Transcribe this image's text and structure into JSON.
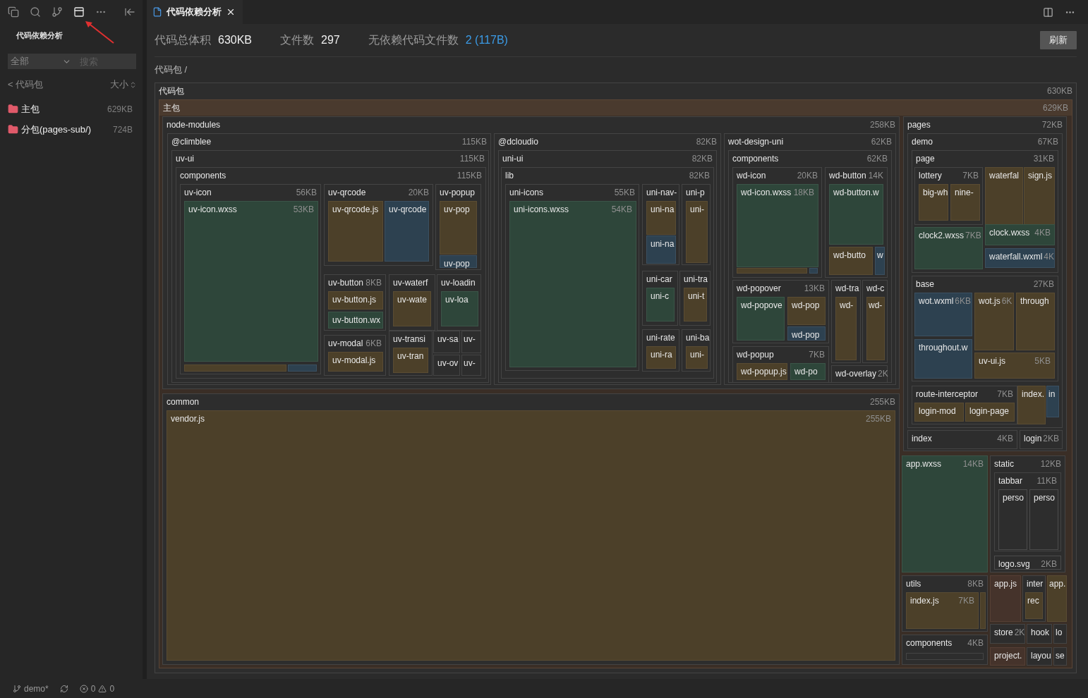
{
  "sidebar": {
    "title": "代码依赖分析",
    "filter": {
      "value": "全部"
    },
    "search": {
      "placeholder": "搜索"
    },
    "header": {
      "back": "< 代码包",
      "sort": "大小"
    },
    "items": [
      {
        "name": "主包",
        "size": "629KB"
      },
      {
        "name": "分包(pages-sub/)",
        "size": "724B"
      }
    ]
  },
  "tab": {
    "title": "代码依赖分析"
  },
  "stats": [
    {
      "label": "代码总体积",
      "value": "630KB",
      "kind": "plain"
    },
    {
      "label": "文件数",
      "value": "297",
      "kind": "plain"
    },
    {
      "label": "无依赖代码文件数",
      "value": "2 (117B)",
      "kind": "link"
    }
  ],
  "refresh_button": "刷新",
  "breadcrumb": "代码包 /",
  "treemap": {
    "name": "代码包",
    "size": "630KB",
    "kind": "folder",
    "children": [
      {
        "name": "主包",
        "size": "629KB",
        "kind": "package",
        "children": [
          {
            "name": "node-modules",
            "size": "258KB",
            "kind": "folder",
            "children": [
              {
                "name": "@climblee",
                "size": "115KB",
                "kind": "folder",
                "children": [
                  {
                    "name": "uv-ui",
                    "size": "115KB",
                    "kind": "folder",
                    "children": [
                      {
                        "name": "components",
                        "size": "115KB",
                        "kind": "folder",
                        "children": [
                          {
                            "name": "uv-icon",
                            "size": "56KB",
                            "kind": "folder",
                            "children": [
                              {
                                "name": "uv-icon.wxss",
                                "size": "53KB",
                                "kind": "style"
                              },
                              {
                                "kind": "script"
                              },
                              {
                                "kind": "markup"
                              }
                            ]
                          },
                          {
                            "name": "uv-qrcode",
                            "size": "20KB",
                            "kind": "folder",
                            "children": [
                              {
                                "name": "uv-qrcode.js",
                                "kind": "script"
                              },
                              {
                                "name": "uv-qrcode",
                                "kind": "markup"
                              }
                            ]
                          },
                          {
                            "name": "uv-popup",
                            "kind": "folder",
                            "children": [
                              {
                                "name": "uv-pop",
                                "kind": "script"
                              },
                              {
                                "name": "uv-pop",
                                "kind": "markup"
                              }
                            ]
                          },
                          {
                            "name": "uv-button",
                            "size": "8KB",
                            "kind": "folder",
                            "children": [
                              {
                                "name": "uv-button.js",
                                "kind": "script"
                              },
                              {
                                "name": "uv-button.wx",
                                "kind": "style"
                              }
                            ]
                          },
                          {
                            "name": "uv-waterf",
                            "kind": "folder",
                            "children": [
                              {
                                "name": "uv-wate",
                                "kind": "script"
                              }
                            ]
                          },
                          {
                            "name": "uv-loadin",
                            "kind": "folder",
                            "children": [
                              {
                                "name": "uv-loa",
                                "kind": "style"
                              }
                            ]
                          },
                          {
                            "name": "uv-modal",
                            "size": "6KB",
                            "kind": "folder",
                            "children": [
                              {
                                "name": "uv-modal.js",
                                "kind": "script"
                              }
                            ]
                          },
                          {
                            "name": "uv-transi",
                            "kind": "folder",
                            "children": [
                              {
                                "name": "uv-tran",
                                "kind": "script"
                              }
                            ]
                          },
                          {
                            "name": "uv-sa",
                            "kind": "folder"
                          },
                          {
                            "name": "uv-",
                            "kind": "folder"
                          },
                          {
                            "name": "uv-ov",
                            "kind": "folder"
                          },
                          {
                            "name": "uv-",
                            "kind": "folder"
                          }
                        ]
                      }
                    ]
                  }
                ]
              },
              {
                "name": "@dcloudio",
                "size": "82KB",
                "kind": "folder",
                "children": [
                  {
                    "name": "uni-ui",
                    "size": "82KB",
                    "kind": "folder",
                    "children": [
                      {
                        "name": "lib",
                        "size": "82KB",
                        "kind": "folder",
                        "children": [
                          {
                            "name": "uni-icons",
                            "size": "55KB",
                            "kind": "folder",
                            "children": [
                              {
                                "name": "uni-icons.wxss",
                                "size": "54KB",
                                "kind": "style"
                              }
                            ]
                          },
                          {
                            "name": "uni-nav-",
                            "kind": "folder",
                            "children": [
                              {
                                "name": "uni-na",
                                "kind": "script"
                              },
                              {
                                "name": "uni-na",
                                "kind": "markup"
                              }
                            ]
                          },
                          {
                            "name": "uni-p",
                            "kind": "folder",
                            "children": [
                              {
                                "name": "uni-",
                                "kind": "script"
                              }
                            ]
                          },
                          {
                            "name": "uni-car",
                            "kind": "folder",
                            "children": [
                              {
                                "name": "uni-c",
                                "kind": "style"
                              }
                            ]
                          },
                          {
                            "name": "uni-tra",
                            "kind": "folder",
                            "children": [
                              {
                                "name": "uni-t",
                                "kind": "script"
                              }
                            ]
                          },
                          {
                            "name": "uni-rate",
                            "kind": "folder",
                            "children": [
                              {
                                "name": "uni-ra",
                                "kind": "script"
                              }
                            ]
                          },
                          {
                            "name": "uni-ba",
                            "kind": "folder",
                            "children": [
                              {
                                "name": "uni-",
                                "kind": "script"
                              }
                            ]
                          }
                        ]
                      }
                    ]
                  }
                ]
              },
              {
                "name": "wot-design-uni",
                "size": "62KB",
                "kind": "folder",
                "children": [
                  {
                    "name": "components",
                    "size": "62KB",
                    "kind": "folder",
                    "children": [
                      {
                        "name": "wd-icon",
                        "size": "20KB",
                        "kind": "folder",
                        "children": [
                          {
                            "name": "wd-icon.wxss",
                            "size": "18KB",
                            "kind": "style"
                          },
                          {
                            "kind": "script"
                          },
                          {
                            "kind": "markup"
                          }
                        ]
                      },
                      {
                        "name": "wd-button",
                        "size": "14K",
                        "kind": "folder",
                        "children": [
                          {
                            "name": "wd-button.w",
                            "kind": "style"
                          },
                          {
                            "name": "wd-butto",
                            "kind": "script"
                          },
                          {
                            "name": "w",
                            "kind": "markup"
                          }
                        ]
                      },
                      {
                        "name": "wd-popover",
                        "size": "13KB",
                        "kind": "folder",
                        "children": [
                          {
                            "name": "wd-popove",
                            "kind": "style"
                          },
                          {
                            "name": "wd-pop",
                            "kind": "script"
                          },
                          {
                            "name": "wd-pop",
                            "kind": "markup"
                          }
                        ]
                      },
                      {
                        "name": "wd-popup",
                        "size": "7KB",
                        "kind": "folder",
                        "children": [
                          {
                            "name": "wd-popup.js",
                            "kind": "script"
                          },
                          {
                            "name": "wd-po",
                            "kind": "style"
                          }
                        ]
                      },
                      {
                        "name": "wd-tra",
                        "kind": "folder",
                        "children": [
                          {
                            "name": "wd-",
                            "kind": "script"
                          }
                        ]
                      },
                      {
                        "name": "wd-c",
                        "kind": "folder",
                        "children": [
                          {
                            "name": "wd-",
                            "kind": "script"
                          }
                        ]
                      },
                      {
                        "name": "wd-overlay",
                        "size": "2K",
                        "kind": "folder"
                      }
                    ]
                  }
                ]
              }
            ]
          },
          {
            "name": "pages",
            "size": "72KB",
            "kind": "folder",
            "children": [
              {
                "name": "demo",
                "size": "67KB",
                "kind": "folder",
                "children": [
                  {
                    "name": "page",
                    "size": "31KB",
                    "kind": "folder",
                    "children": [
                      {
                        "name": "lottery",
                        "size": "7KB",
                        "kind": "folder",
                        "children": [
                          {
                            "name": "big-wh",
                            "kind": "script"
                          },
                          {
                            "name": "nine-",
                            "kind": "script"
                          }
                        ]
                      },
                      {
                        "name": "waterfal",
                        "kind": "script"
                      },
                      {
                        "name": "sign.js",
                        "kind": "script"
                      },
                      {
                        "name": "clock2.wxss",
                        "size": "7KB",
                        "kind": "style"
                      },
                      {
                        "name": "clock.wxss",
                        "size": "4KB",
                        "kind": "style"
                      },
                      {
                        "name": "waterfall.wxml",
                        "size": "4K",
                        "kind": "markup"
                      }
                    ]
                  },
                  {
                    "name": "base",
                    "size": "27KB",
                    "kind": "folder",
                    "children": [
                      {
                        "name": "wot.wxml",
                        "size": "6KB",
                        "kind": "markup"
                      },
                      {
                        "name": "wot.js",
                        "size": "6K",
                        "kind": "script"
                      },
                      {
                        "name": "through",
                        "kind": "script"
                      },
                      {
                        "name": "throughout.w",
                        "kind": "markup"
                      },
                      {
                        "name": "uv-ui.js",
                        "size": "5KB",
                        "kind": "script"
                      }
                    ]
                  },
                  {
                    "name": "route-interceptor",
                    "size": "7KB",
                    "kind": "folder",
                    "children": [
                      {
                        "name": "login-mod",
                        "kind": "script"
                      },
                      {
                        "name": "login-page",
                        "kind": "script"
                      }
                    ]
                  },
                  {
                    "name": "index.",
                    "kind": "script"
                  },
                  {
                    "name": "in",
                    "kind": "markup"
                  }
                ]
              },
              {
                "name": "index",
                "size": "4KB",
                "kind": "folder"
              },
              {
                "name": "login",
                "size": "2KB",
                "kind": "folder"
              }
            ]
          },
          {
            "name": "common",
            "size": "255KB",
            "kind": "folder",
            "children": [
              {
                "name": "vendor.js",
                "size": "255KB",
                "kind": "script"
              }
            ]
          },
          {
            "name": "app.wxss",
            "size": "14KB",
            "kind": "style"
          },
          {
            "name": "static",
            "size": "12KB",
            "kind": "folder",
            "children": [
              {
                "name": "tabbar",
                "size": "11KB",
                "kind": "folder",
                "children": [
                  {
                    "name": "perso",
                    "kind": "image"
                  },
                  {
                    "name": "perso",
                    "kind": "image"
                  }
                ]
              },
              {
                "name": "logo.svg",
                "size": "2KB",
                "kind": "image"
              }
            ]
          },
          {
            "name": "utils",
            "size": "8KB",
            "kind": "folder",
            "children": [
              {
                "name": "index.js",
                "size": "7KB",
                "kind": "script"
              },
              {
                "kind": "script"
              }
            ]
          },
          {
            "name": "app.js",
            "kind": "config"
          },
          {
            "name": "inter",
            "kind": "folder",
            "children": [
              {
                "name": "rec",
                "kind": "script"
              }
            ]
          },
          {
            "name": "app.",
            "kind": "script"
          },
          {
            "name": "store",
            "size": "2K",
            "kind": "folder"
          },
          {
            "name": "hook",
            "kind": "folder"
          },
          {
            "name": "lo",
            "kind": "folder"
          },
          {
            "name": "project.",
            "kind": "config"
          },
          {
            "name": "layou",
            "kind": "folder"
          },
          {
            "name": "se",
            "kind": "folder"
          },
          {
            "name": "components",
            "size": "4KB",
            "kind": "folder",
            "children": [
              {
                "kind": "folder"
              }
            ]
          }
        ]
      }
    ]
  },
  "status_bar": {
    "branch": "demo*",
    "errors": "0",
    "warnings": "0"
  }
}
